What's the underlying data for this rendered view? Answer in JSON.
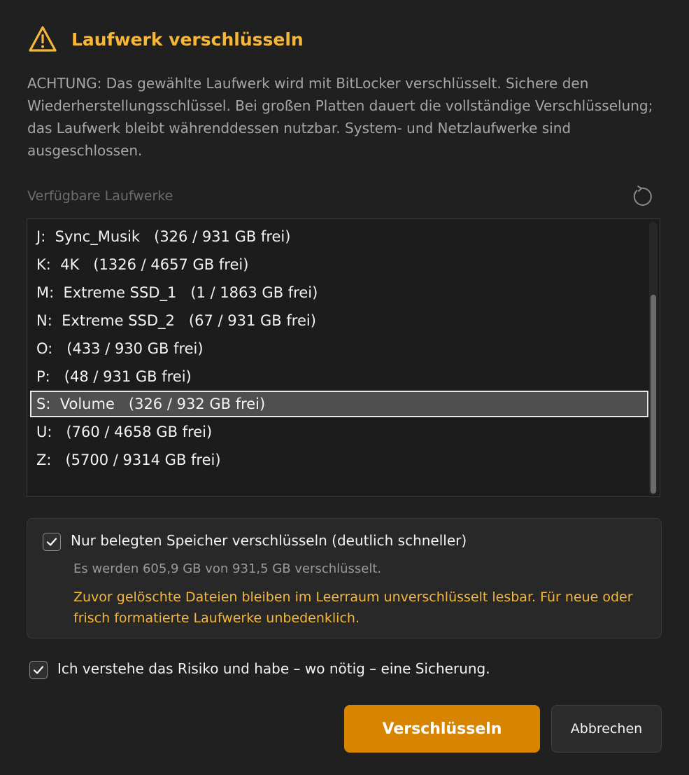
{
  "dialog": {
    "title": "Laufwerk verschlüsseln",
    "warning_icon": "warning-triangle-icon",
    "description": "ACHTUNG: Das gewählte Laufwerk wird mit BitLocker verschlüsselt. Sichere den Wiederherstellungsschlüssel. Bei großen Platten dauert die vollständige Verschlüsselung; das Laufwerk bleibt währenddessen nutzbar. System- und Netzlaufwerke sind ausgeschlossen."
  },
  "drives": {
    "label": "Verfügbare Laufwerke",
    "refresh_icon": "refresh-icon",
    "items": [
      {
        "label": "J:  Sync_Musik   (326 / 931 GB frei)"
      },
      {
        "label": "K:  4K   (1326 / 4657 GB frei)"
      },
      {
        "label": "M:  Extreme SSD_1   (1 / 1863 GB frei)"
      },
      {
        "label": "N:  Extreme SSD_2   (67 / 931 GB frei)"
      },
      {
        "label": "O:   (433 / 930 GB frei)"
      },
      {
        "label": "P:   (48 / 931 GB frei)"
      },
      {
        "label": "S:  Volume   (326 / 932 GB frei)"
      },
      {
        "label": "U:   (760 / 4658 GB frei)"
      },
      {
        "label": "Z:   (5700 / 9314 GB frei)"
      }
    ],
    "selected_index": 6
  },
  "options": {
    "used_space_only": {
      "label": "Nur belegten Speicher verschlüsseln (deutlich schneller)",
      "checked": true,
      "info": "Es werden 605,9 GB von 931,5 GB verschlüsselt.",
      "warning": "Zuvor gelöschte Dateien bleiben im Leerraum unverschlüsselt lesbar. Für neue oder frisch formatierte Laufwerke unbedenklich."
    },
    "risk_ack": {
      "label": "Ich verstehe das Risiko und habe – wo nötig – eine Sicherung.",
      "checked": true
    }
  },
  "buttons": {
    "primary": "Verschlüsseln",
    "cancel": "Abbrechen"
  },
  "colors": {
    "accent": "#f4b73a",
    "primary_button": "#d78400",
    "background": "#202020"
  }
}
